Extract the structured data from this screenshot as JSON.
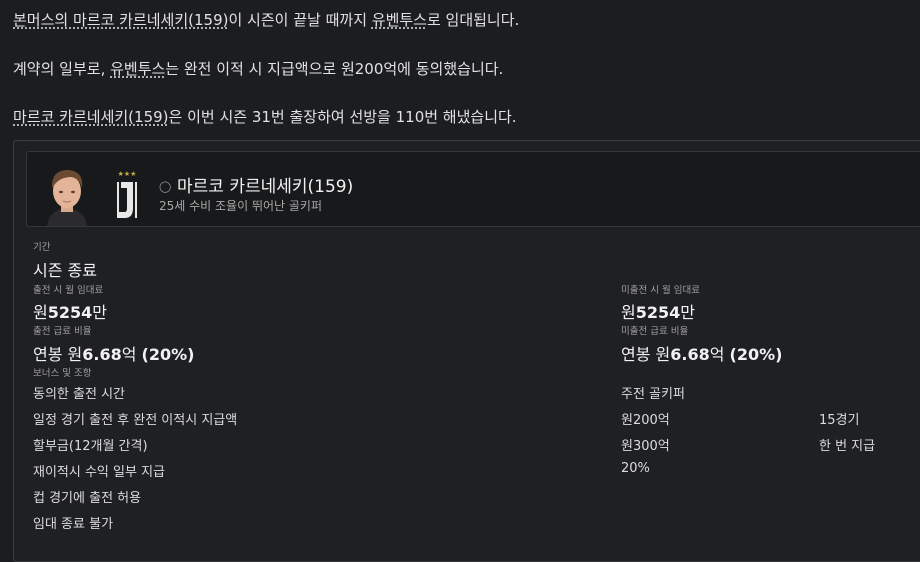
{
  "news": {
    "line1": {
      "player": "본머스의 마르코 카르네세키(159)",
      "mid": "이 시즌이 끝날 때까지 ",
      "club": "유벤투스",
      "end": "로 임대됩니다."
    },
    "line2": {
      "start": "계약의 일부로, ",
      "club": "유벤투스",
      "end": "는 완전 이적 시 지급액으로 원200억에 동의했습니다."
    },
    "line3": {
      "player": "마르코 카르네세키(159)",
      "end": "은 이번 시즌 31번 출장하여 선방을 110번 해냈습니다."
    }
  },
  "player": {
    "name": "마르코 카르네세키(159)",
    "description": "25세 수비 조율이 뛰어난 골키퍼"
  },
  "loan": {
    "period_label": "기간",
    "period_value": "시즌 종료",
    "fee_played_label": "출전 시 월 임대료",
    "fee_played": {
      "prefix": "원",
      "number": "5254",
      "suffix": "만"
    },
    "fee_unplayed_label": "미출전 시 월 임대료",
    "fee_unplayed": {
      "prefix": "원",
      "number": "5254",
      "suffix": "만"
    },
    "wage_played_label": "출전 급료 비율",
    "wage_played": {
      "prefix": "연봉 원",
      "number": "6.68",
      "suffix": "억 ",
      "pct": "(20%)"
    },
    "wage_unplayed_label": "미출전 급료 비율",
    "wage_unplayed": {
      "prefix": "연봉 원",
      "number": "6.68",
      "suffix": "억 ",
      "pct": "(20%)"
    },
    "bonus_label": "보너스 및 조항",
    "clauses": [
      {
        "name": "동의한 출전 시간",
        "value": "주전 골키퍼",
        "extra": ""
      },
      {
        "name": "일정 경기 출전 후 완전 이적시 지급액",
        "value": "원200억",
        "extra": "15경기"
      },
      {
        "name": "할부금(12개월 간격)",
        "value": "원300억",
        "extra": "한 번 지급"
      },
      {
        "name": "재이적시 수익 일부 지급",
        "value": "20%",
        "extra": ""
      },
      {
        "name": "컵 경기에 출전 허용",
        "value": "",
        "extra": ""
      },
      {
        "name": "임대 종료 불가",
        "value": "",
        "extra": ""
      }
    ]
  },
  "colors": {
    "background": "#1c1d20",
    "card": "#1f2023",
    "border": "#3a3b3f"
  }
}
